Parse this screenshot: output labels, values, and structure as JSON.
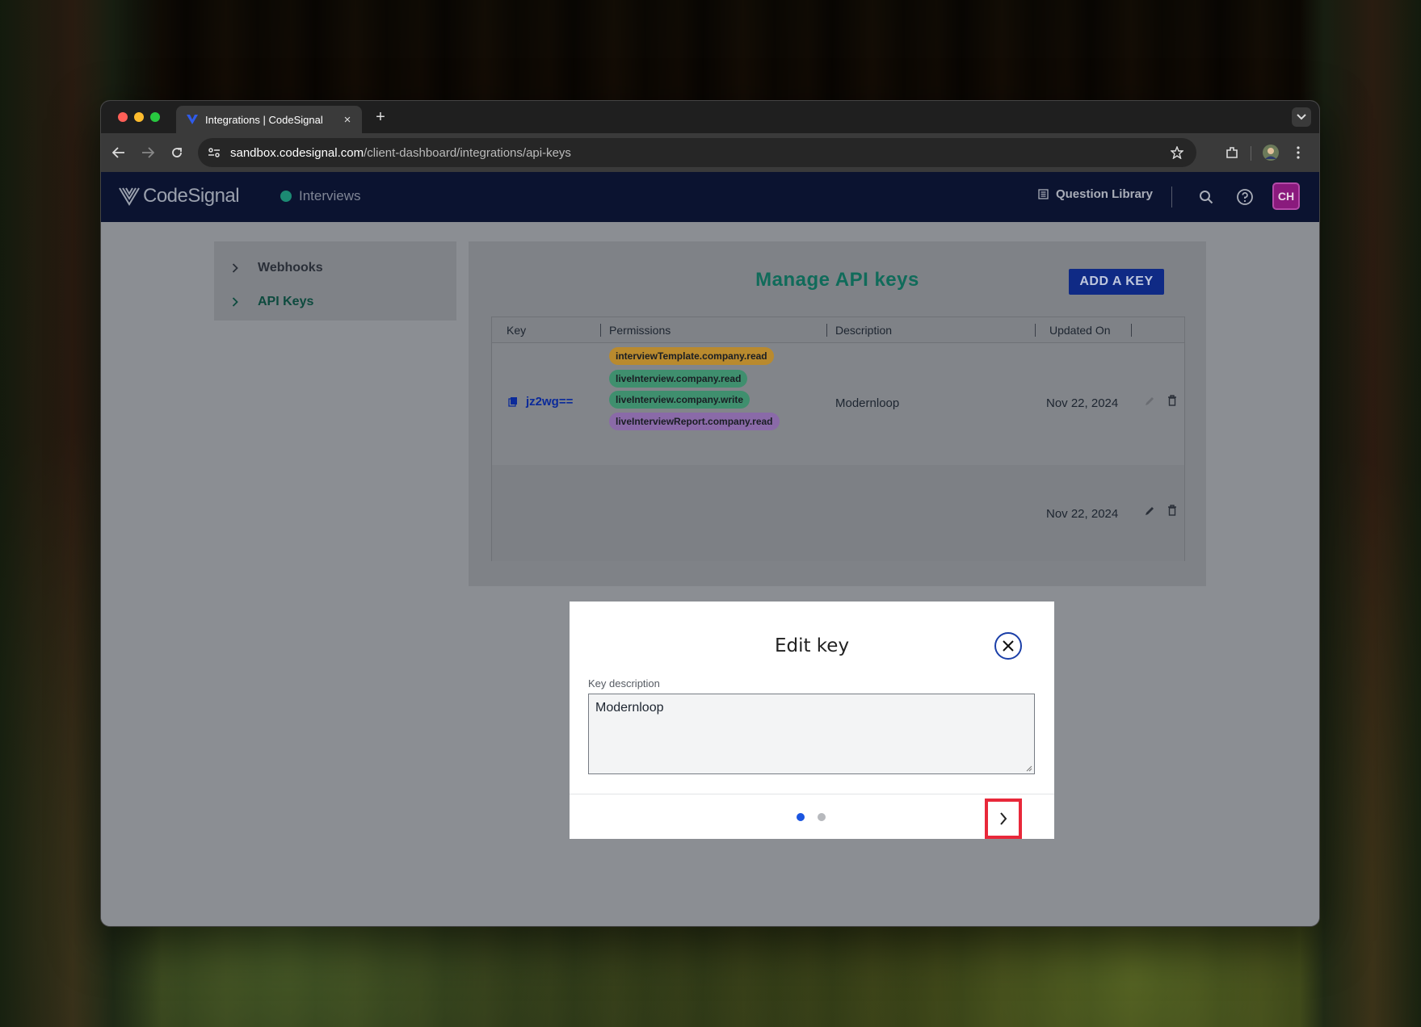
{
  "browser": {
    "tab_title": "Integrations | CodeSignal",
    "tab_close": "×",
    "new_tab": "+",
    "url_host": "sandbox.codesignal.com",
    "url_path": "/client-dashboard/integrations/api-keys"
  },
  "appbar": {
    "logo_text": "CodeSignal",
    "nav_interviews": "Interviews",
    "question_library": "Question Library",
    "avatar_initials": "CH",
    "avatar_color": "#8a1a7d"
  },
  "sidebar": {
    "items": [
      {
        "label": "Webhooks"
      },
      {
        "label": "API Keys"
      }
    ]
  },
  "main": {
    "title": "Manage API keys",
    "add_button": "ADD A KEY",
    "columns": [
      "Key",
      "Permissions",
      "Description",
      "Updated On"
    ],
    "rows": [
      {
        "key": "jz2wg==",
        "permissions": [
          {
            "label": "interviewTemplate.company.read",
            "color": "#b98a2e"
          },
          {
            "label": "liveInterview.company.read",
            "color": "#3f8f6e"
          },
          {
            "label": "liveInterview.company.write",
            "color": "#3f8f6e"
          },
          {
            "label": "liveInterviewReport.company.read",
            "color": "#8a6aa8"
          }
        ],
        "description": "Modernloop",
        "updated_on": "Nov 22, 2024"
      },
      {
        "updated_on": "Nov 22, 2024"
      }
    ]
  },
  "modal": {
    "title": "Edit key",
    "field_label": "Key description",
    "field_value": "Modernloop",
    "page_current": 1,
    "page_total": 2,
    "active_dot_color": "#1b55e0",
    "inactive_dot_color": "#b7b9bd",
    "highlight_color": "#e8283a"
  }
}
